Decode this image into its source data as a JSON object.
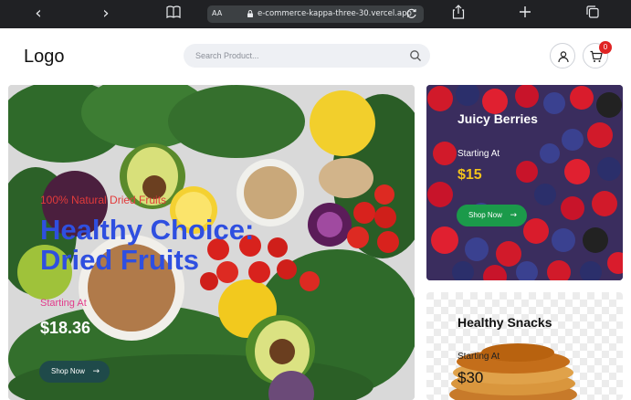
{
  "browser": {
    "text_size_label": "AA",
    "url": "e-commerce-kappa-three-30.vercel.app",
    "icons": [
      "chevron-left-icon",
      "chevron-right-icon",
      "book-icon",
      "lock-icon",
      "reload-icon",
      "share-icon",
      "plus-icon",
      "tabs-icon"
    ]
  },
  "header": {
    "logo": "Logo",
    "search_placeholder": "Search Product...",
    "cart_count": "0",
    "icons": [
      "search-icon",
      "user-icon",
      "cart-icon"
    ]
  },
  "hero": {
    "tag": "100% Natural Dried Fruits",
    "title": "Healthy Choice: Dried Fruits",
    "starting_label": "Starting At",
    "price": "$18.36",
    "button_label": "Shop Now",
    "button_arrow": "→"
  },
  "cards": [
    {
      "title": "Juicy Berries",
      "starting_label": "Starting At",
      "price": "$15",
      "button_label": "Shop Now",
      "button_arrow": "→"
    },
    {
      "title": "Healthy Snacks",
      "starting_label": "Starting At",
      "price": "$30"
    }
  ],
  "colors": {
    "chrome_bg": "#202124",
    "hero_title": "#2f4fe0",
    "hero_tag": "#e23b3b",
    "hero_button": "#1f4a4a",
    "berries_button": "#1b9a4a",
    "berries_price": "#f2c31b",
    "badge": "#e02424"
  }
}
